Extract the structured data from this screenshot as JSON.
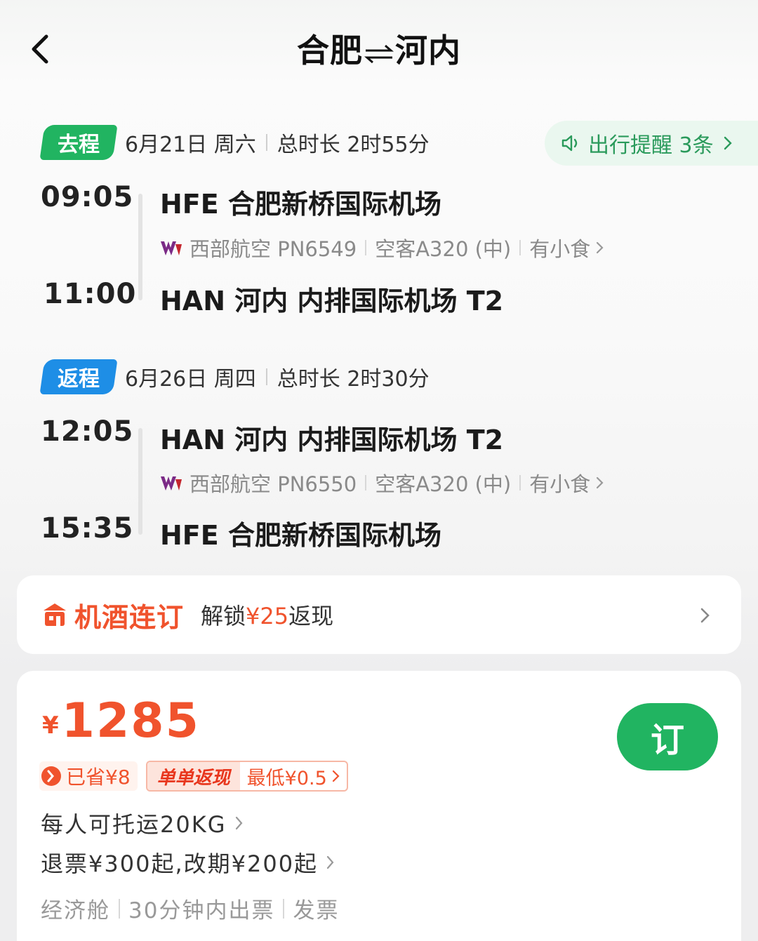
{
  "header": {
    "from": "合肥",
    "to": "河内"
  },
  "reminder": {
    "label": "出行提醒 3条"
  },
  "outbound": {
    "tag": "去程",
    "date": "6月21日 周六",
    "duration": "总时长 2时55分",
    "depart_time": "09:05",
    "depart_airport": "HFE 合肥新桥国际机场",
    "airline": "西部航空 PN6549",
    "aircraft": "空客A320 (中)",
    "meal": "有小食",
    "arrive_time": "11:00",
    "arrive_airport": "HAN 河内 内排国际机场 T2"
  },
  "return": {
    "tag": "返程",
    "date": "6月26日 周四",
    "duration": "总时长 2时30分",
    "depart_time": "12:05",
    "depart_airport": "HAN 河内 内排国际机场 T2",
    "airline": "西部航空 PN6550",
    "aircraft": "空客A320 (中)",
    "meal": "有小食",
    "arrive_time": "15:35",
    "arrive_airport": "HFE 合肥新桥国际机场"
  },
  "package": {
    "title": "机酒连订",
    "sub_prefix": "解锁",
    "sub_amount": "¥25",
    "sub_suffix": "返现"
  },
  "price_card": {
    "currency": "¥",
    "price": "1285",
    "book_label": "订",
    "saved": "已省¥8",
    "cashback_label": "单单返现",
    "cashback_min": "最低¥0.5",
    "baggage": "每人可托运20KG",
    "refund": "退票¥300起,改期¥200起",
    "cabin": "经济舱",
    "ticketing": "30分钟内出票",
    "invoice": "发票"
  },
  "colors": {
    "green": "#21b461",
    "blue": "#1e8ee6",
    "orange": "#f0532d"
  }
}
